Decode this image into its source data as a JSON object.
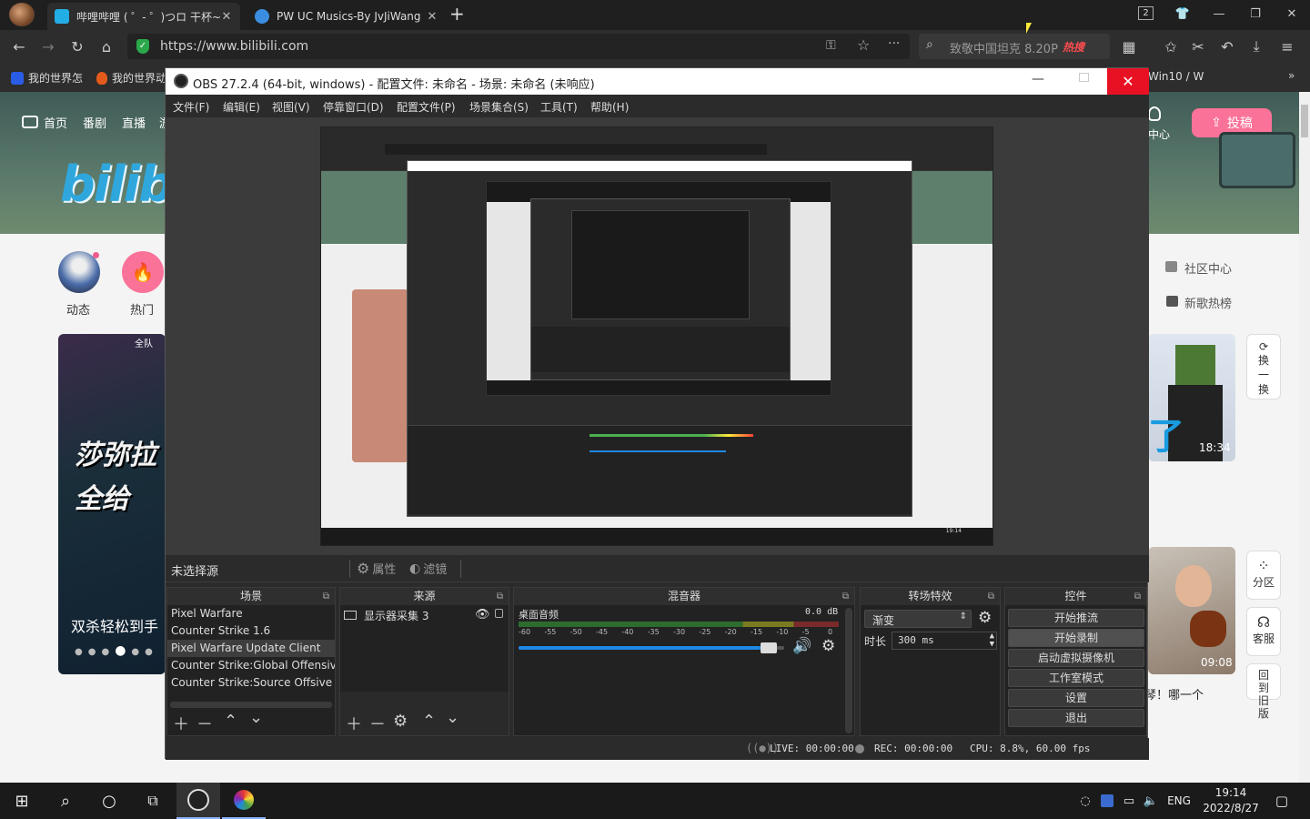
{
  "browser": {
    "tabs": [
      {
        "title": "哔哩哔哩 ( ゜- ゜)つロ 干杯~-"
      },
      {
        "title": "PW UC Musics-By JvJiWang"
      }
    ],
    "new_tab": "+",
    "window_count": "2",
    "url": "https://www.bilibili.com",
    "search_placeholder": "致敬中国坦克 8.20P",
    "hot_badge": "热搜",
    "bookmarks": [
      "我的世界怎",
      "我的世界动",
      "Win10 / W"
    ]
  },
  "bilibili": {
    "nav": [
      "首页",
      "番剧",
      "直播",
      "游"
    ],
    "logo": "bilibili",
    "upload": "投稿",
    "creator_center": "中心",
    "shortcuts": [
      "动态",
      "热门"
    ],
    "side_links": [
      "社区中心",
      "新歌热榜"
    ],
    "refresh": "换一换",
    "video_cards": [
      {
        "duration": "18:34",
        "caption": "了"
      },
      {
        "duration": "09:08",
        "caption": "琴！哪一个"
      }
    ],
    "carousel_caption": "双杀轻松到手",
    "carousel_heading": "莎弥拉 全给",
    "float_btns": [
      "分区",
      "客服",
      "回到旧版"
    ],
    "promo_top": "全队"
  },
  "obs": {
    "title": "OBS 27.2.4 (64-bit, windows) - 配置文件: 未命名 - 场景: 未命名 (未响应)",
    "menu": [
      "文件(F)",
      "编辑(E)",
      "视图(V)",
      "停靠窗口(D)",
      "配置文件(P)",
      "场景集合(S)",
      "工具(T)",
      "帮助(H)"
    ],
    "no_source": "未选择源",
    "properties": "属性",
    "filters": "滤镜",
    "docks": {
      "scenes": "场景",
      "sources": "来源",
      "mixer": "混音器",
      "transitions": "转场特效",
      "controls": "控件"
    },
    "scenes": [
      "Pixel Warfare",
      "Counter Strike 1.6",
      "Pixel Warfare Update Client",
      "Counter Strike:Global Offensive",
      "Counter Strike:Source Offsive"
    ],
    "selected_scene_index": 2,
    "sources": [
      {
        "name": "显示器采集 3"
      }
    ],
    "mixer": {
      "track": "桌面音频",
      "db": "0.0 dB",
      "scale": [
        "-60",
        "-55",
        "-50",
        "-45",
        "-40",
        "-35",
        "-30",
        "-25",
        "-20",
        "-15",
        "-10",
        "-5",
        "0"
      ],
      "volume": 0.97
    },
    "transition": {
      "type": "渐变",
      "duration_label": "时长",
      "duration": "300 ms"
    },
    "controls": [
      "开始推流",
      "开始录制",
      "启动虚拟摄像机",
      "工作室模式",
      "设置",
      "退出"
    ],
    "status": {
      "live": "LIVE: 00:00:00",
      "rec": "REC: 00:00:00",
      "cpu": "CPU: 8.8%, 60.00 fps"
    }
  },
  "taskbar": {
    "lang": "ENG",
    "time": "19:14",
    "date": "2022/8/27"
  },
  "colors": {
    "bili_pink": "#fb7299",
    "obs_bg": "#2b2b2b",
    "close_red": "#e81123",
    "meter_green": "#4caf50",
    "slider_blue": "#1e88e5"
  }
}
